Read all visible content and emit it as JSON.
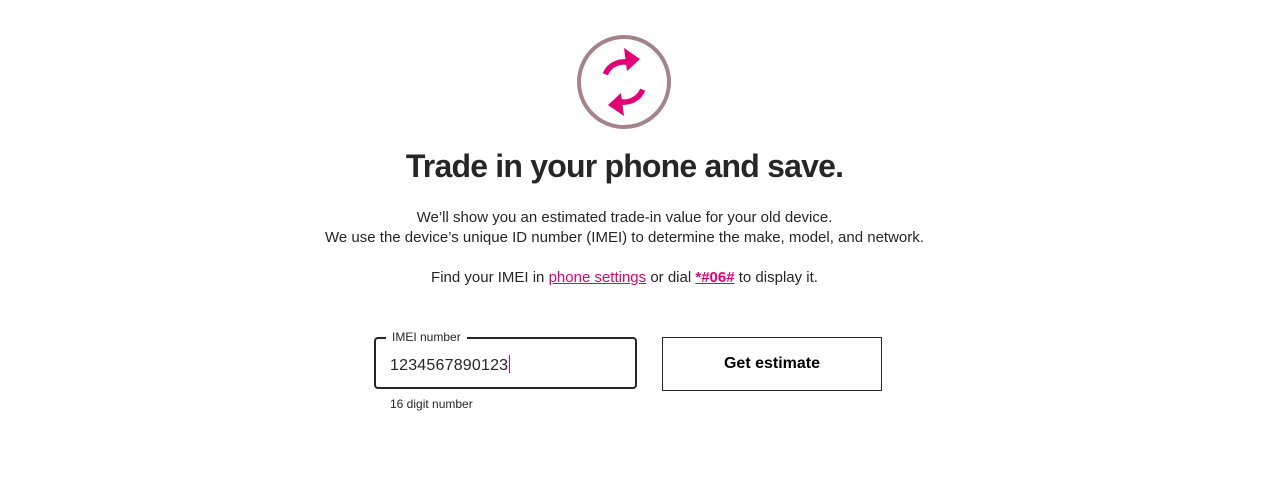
{
  "icons": {
    "hero": "refresh-icon"
  },
  "colors": {
    "accent": "#e20074",
    "ring": "#a48489",
    "text": "#262626"
  },
  "header": {
    "title": "Trade in your phone and save."
  },
  "description": {
    "line1": "We’ll show you an estimated trade-in value for your old device.",
    "line2": "We use the device’s unique ID number (IMEI) to determine the make, model, and network.",
    "find_prefix": "Find your IMEI in",
    "settings_link": "phone settings",
    "dial_text": "or dial",
    "dial_code": "*#06#",
    "find_suffix": "to display it."
  },
  "imei_field": {
    "label": "IMEI number",
    "value": "1234567890123",
    "helper": "16 digit number"
  },
  "cta": {
    "label": "Get estimate"
  }
}
